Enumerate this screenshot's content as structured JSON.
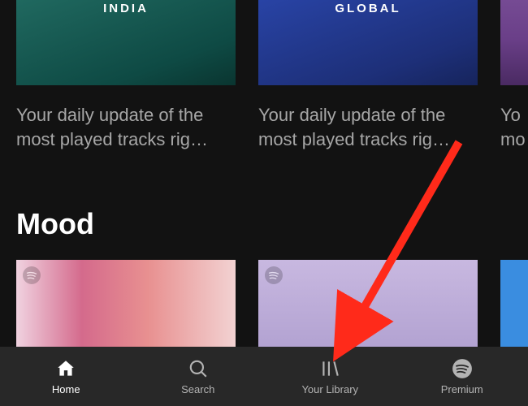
{
  "carousel": {
    "items": [
      {
        "cover_label": "INDIA",
        "description": "Your daily update of the most played tracks rig…"
      },
      {
        "cover_label": "GLOBAL",
        "description": "Your daily update of the most played tracks rig…"
      },
      {
        "cover_label": "",
        "description": "Your daily update of the mo…"
      }
    ]
  },
  "section": {
    "title": "Mood"
  },
  "nav": {
    "home": {
      "label": "Home"
    },
    "search": {
      "label": "Search"
    },
    "library": {
      "label": "Your Library"
    },
    "premium": {
      "label": "Premium"
    }
  }
}
